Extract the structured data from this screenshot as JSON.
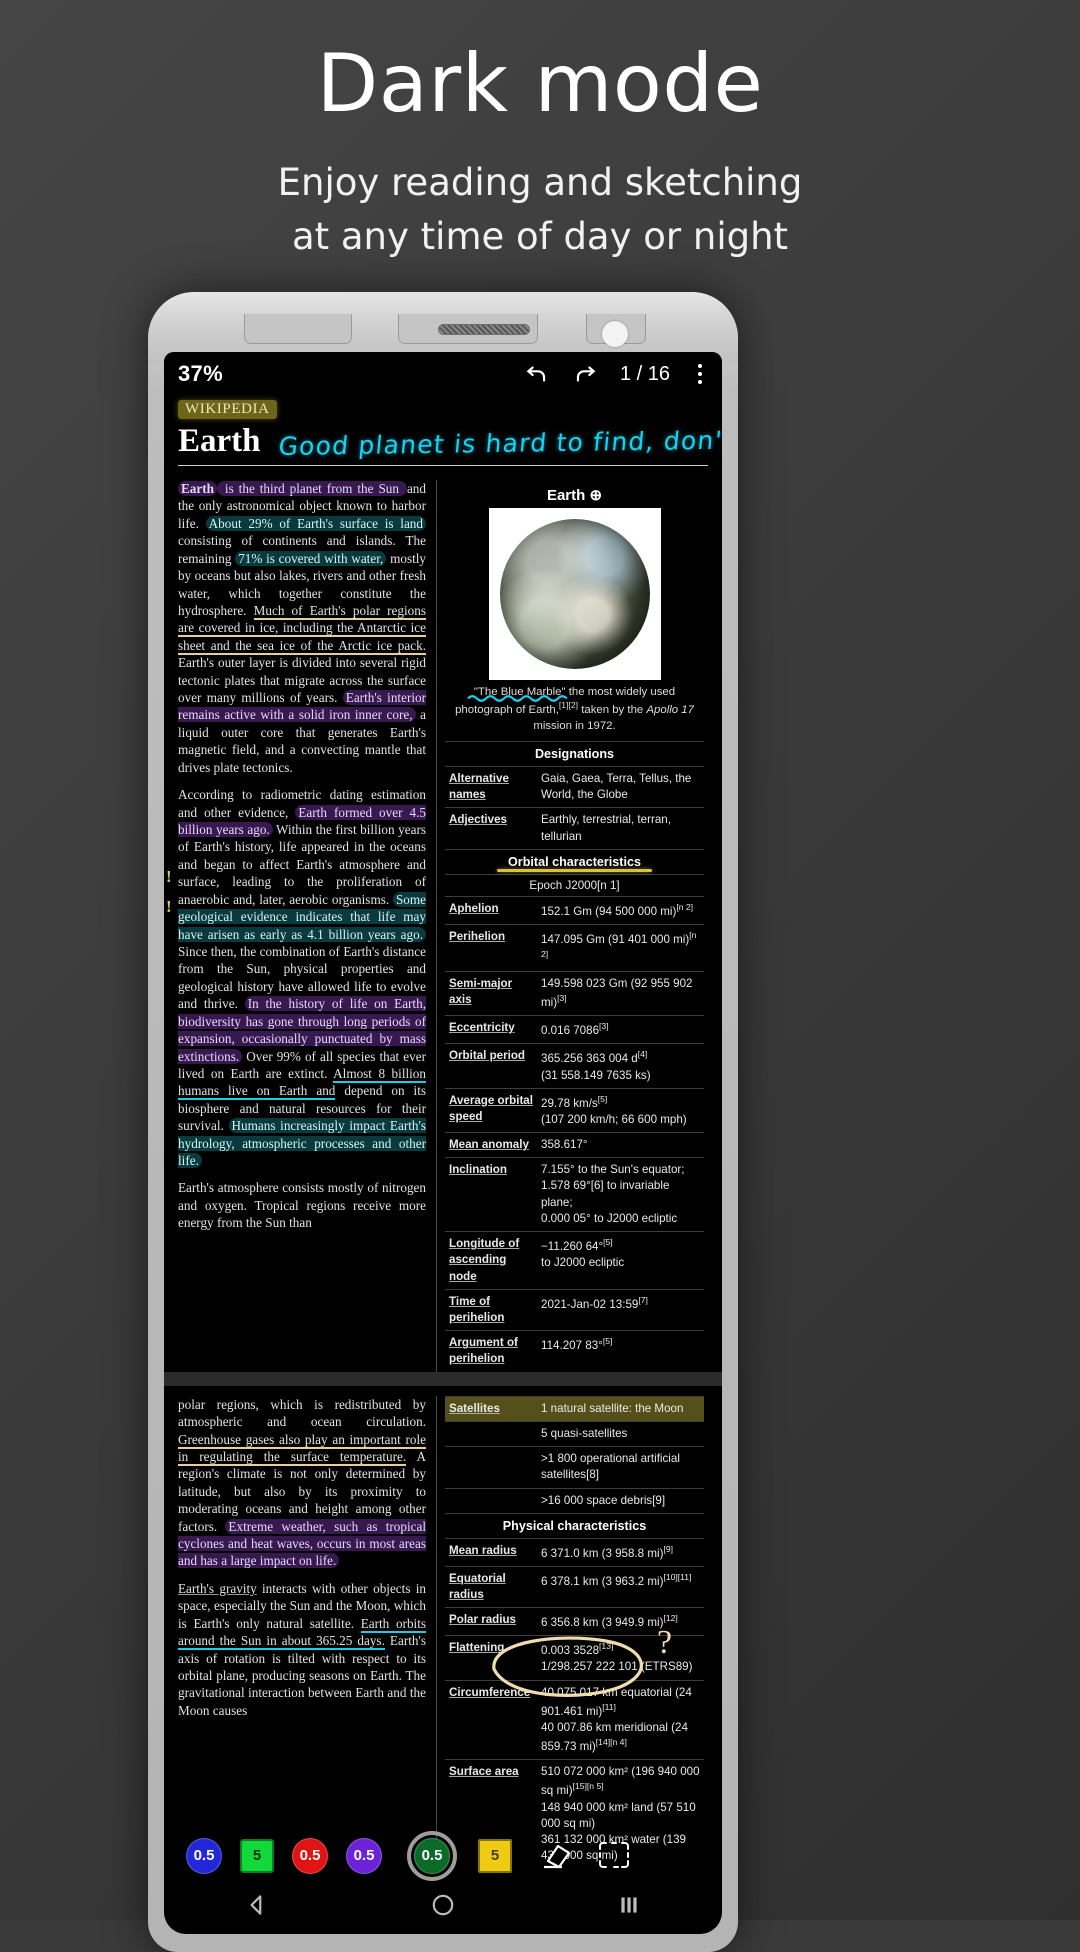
{
  "promo": {
    "title": "Dark mode",
    "subtitle_line1": "Enjoy reading and sketching",
    "subtitle_line2": "at any time of day or night"
  },
  "toolbar": {
    "zoom_level": "37%",
    "undo_icon": "undo-icon",
    "redo_icon": "redo-icon",
    "page_indicator": "1 / 16",
    "menu_icon": "overflow-menu-icon"
  },
  "document": {
    "source_badge": "WIKIPEDIA",
    "title": "Earth",
    "handwritten_note": "Good planet is hard to find, don't blow it !",
    "paragraph1": [
      {
        "t": "Earth",
        "s": "bold hl-purple"
      },
      {
        "t": " is the third planet from the Sun ",
        "s": "hl-purple"
      },
      {
        "t": "and the only astronomical object known to harbor life. ",
        "s": ""
      },
      {
        "t": "About 29% of Earth's surface is land ",
        "s": "hl-teal"
      },
      {
        "t": "consisting of continents and islands. The remaining ",
        "s": ""
      },
      {
        "t": "71% is covered with water,",
        "s": "hl-teal"
      },
      {
        "t": " mostly by oceans but also lakes, rivers and other fresh water, which together constitute the hydrosphere. ",
        "s": ""
      },
      {
        "t": "Much of Earth's polar regions are covered in ice, including the Antarctic ice sheet and the sea ice of the Arctic ice pack.",
        "s": "ul-tan"
      },
      {
        "t": " Earth's outer layer is divided into several rigid tectonic plates that migrate across the surface over many millions of years. ",
        "s": ""
      },
      {
        "t": "Earth's interior remains active with a solid iron inner core,",
        "s": "hl-purple"
      },
      {
        "t": " a liquid outer core that generates Earth's magnetic field, and a convecting mantle that drives plate tectonics.",
        "s": ""
      }
    ],
    "paragraph2": [
      {
        "t": "According to radiometric dating estimation and other evidence, ",
        "s": ""
      },
      {
        "t": "Earth formed over 4.5 billion years ago.",
        "s": "hl-purple"
      },
      {
        "t": " Within the first billion years of Earth's history, life appeared in the oceans and began to affect Earth's atmosphere and surface, leading to the proliferation of anaerobic and, later, aerobic organisms. ",
        "s": ""
      },
      {
        "t": "Some geological evidence indicates that life may have arisen as early as 4.1 billion years ago.",
        "s": "hl-teal"
      },
      {
        "t": " Since then, the combination of Earth's distance from the Sun, physical properties and geological history have allowed life to evolve and thrive. ",
        "s": ""
      },
      {
        "t": "In the history of life on Earth, biodiversity has gone through long periods of expansion, occasionally punctuated by mass extinctions.",
        "s": "hl-purple"
      },
      {
        "t": " Over 99% of all species that ever lived on Earth are extinct. ",
        "s": ""
      },
      {
        "t": "Almost 8 billion humans live on Earth and",
        "s": "ul-cyan"
      },
      {
        "t": " depend on its biosphere and natural resources for their survival. ",
        "s": ""
      },
      {
        "t": "Humans increasingly impact Earth's hydrology, atmospheric processes and other life.",
        "s": "hl-teal"
      }
    ],
    "paragraph3": [
      {
        "t": "Earth's atmosphere consists mostly of nitrogen and oxygen. Tropical regions receive more energy from the Sun than",
        "s": ""
      }
    ],
    "paragraph4": [
      {
        "t": "polar regions, which is redistributed by atmospheric and ocean circulation. ",
        "s": ""
      },
      {
        "t": "Greenhouse gases also play an important role in regulating the surface temperature.",
        "s": "ul-tan"
      },
      {
        "t": " A region's climate is not only determined by latitude, but also by its proximity to moderating oceans and height among other factors. ",
        "s": ""
      },
      {
        "t": "Extreme weather, such as tropical cyclones and heat waves, occurs in most areas and has a large impact on life.",
        "s": "hl-purple"
      }
    ],
    "paragraph5": [
      {
        "t": "Earth's gravity",
        "s": "u"
      },
      {
        "t": " interacts with other objects in space, especially the Sun and the Moon, which is Earth's only natural satellite. ",
        "s": ""
      },
      {
        "t": "Earth orbits around the Sun in about 365.25 days.",
        "s": "ul-cyan"
      },
      {
        "t": " Earth's axis of rotation is tilted with respect to its orbital plane, producing seasons on Earth. The gravitational interaction between Earth and the Moon causes",
        "s": ""
      }
    ]
  },
  "infobox": {
    "title": "Earth",
    "title_symbol": "⊕",
    "image_alt": "blue-marble-photo",
    "caption_quoted": "\"The Blue Marble\"",
    "caption_rest": " the most widely used photograph of Earth,",
    "caption_refs": "[1][2]",
    "caption_tail": " taken by the ",
    "caption_italic": "Apollo 17",
    "caption_end": " mission in 1972.",
    "sections": [
      {
        "heading": "Designations",
        "rows": [
          {
            "k": "Alternative names",
            "v": "Gaia, Gaea, Terra, Tellus, the World, the Globe"
          },
          {
            "k": "Adjectives",
            "v": "Earthly, terrestrial, terran, tellurian"
          }
        ]
      },
      {
        "heading": "Orbital characteristics",
        "highlight": "yellow-underline",
        "epoch": "Epoch J2000[n 1]",
        "rows": [
          {
            "k": "Aphelion",
            "v": "152.1 Gm (94 500 000 mi)",
            "ref": "[n 2]"
          },
          {
            "k": "Perihelion",
            "v": "147.095 Gm (91 401 000 mi)",
            "ref": "[n 2]"
          },
          {
            "k": "Semi-major axis",
            "v": "149.598 023 Gm (92 955 902 mi)",
            "ref": "[3]"
          },
          {
            "k": "Eccentricity",
            "v": "0.016 7086",
            "ref": "[3]"
          },
          {
            "k": "Orbital period",
            "v": "365.256 363 004 d",
            "ref": "[4]",
            "v2": "(31 558.149 7635 ks)"
          },
          {
            "k": "Average orbital speed",
            "v": "29.78 km/s",
            "ref": "[5]",
            "v2": "(107 200 km/h; 66 600 mph)"
          },
          {
            "k": "Mean anomaly",
            "v": "358.617°",
            "ref": ""
          },
          {
            "k": "Inclination",
            "v": "7.155° to the Sun's equator;",
            "ref": "",
            "v2": "1.578 69°[6] to invariable plane;",
            "v3": "0.000 05° to J2000 ecliptic"
          },
          {
            "k": "Longitude of ascending node",
            "v": "−11.260 64°",
            "ref": "[5]",
            "v2": " to J2000 ecliptic"
          },
          {
            "k": "Time of perihelion",
            "v": "2021-Jan-02 13:59",
            "ref": "[7]"
          },
          {
            "k": "Argument of perihelion",
            "v": "114.207 83°",
            "ref": "[5]"
          }
        ]
      }
    ],
    "page2": {
      "satellites_key": "Satellites",
      "satellites_values": [
        "1 natural satellite: the Moon",
        "5 quasi-satellites",
        ">1 800 operational artificial satellites[8]",
        ">16 000 space debris[9]"
      ],
      "physical_heading": "Physical characteristics",
      "rows": [
        {
          "k": "Mean radius",
          "v": "6 371.0 km (3 958.8 mi)",
          "ref": "[9]"
        },
        {
          "k": "Equatorial radius",
          "v": "6 378.1 km (3 963.2 mi)",
          "ref": "[10][11]"
        },
        {
          "k": "Polar radius",
          "v": "6 356.8 km (3 949.9 mi)",
          "ref": "[12]"
        },
        {
          "k": "Flattening",
          "v": "0.003 3528",
          "ref": "[13]",
          "v2": "1/298.257 222 101 (ETRS89)"
        },
        {
          "k": "Circumference",
          "v": "40 075.017 km equatorial (24 901.461 mi)",
          "ref": "[11]",
          "v2": "40 007.86 km meridional (24 859.73 mi)",
          "ref2": "[14][n 4]"
        },
        {
          "k": "Surface area",
          "v": "510 072 000 km² (196 940 000 sq mi)",
          "ref": "[15][n 5]",
          "v2": "148 940 000 km² land (57 510 000 sq mi)",
          "v3": "361 132 000 km² water (139 434 000 sq mi)"
        }
      ]
    }
  },
  "pen_toolbar": {
    "tools": [
      {
        "name": "pen-blue",
        "label": "0.5",
        "color": "#2227d8",
        "shape": "circle",
        "selected": false
      },
      {
        "name": "highlighter-green",
        "label": "5",
        "color": "#12d93a",
        "shape": "square",
        "selected": false
      },
      {
        "name": "pen-red",
        "label": "0.5",
        "color": "#e01414",
        "shape": "circle",
        "selected": false
      },
      {
        "name": "pen-violet",
        "label": "0.5",
        "color": "#6b22d8",
        "shape": "circle",
        "selected": false
      },
      {
        "name": "pen-green",
        "label": "0.5",
        "color": "#0a6a2a",
        "shape": "circle",
        "selected": true
      },
      {
        "name": "highlighter-yellow",
        "label": "5",
        "color": "#f0cb14",
        "shape": "square",
        "selected": false
      }
    ],
    "eraser_icon": "eraser-icon",
    "lasso_icon": "lasso-select-icon"
  },
  "navbar": {
    "back_icon": "back-triangle-icon",
    "home_icon": "home-circle-icon",
    "recents_icon": "recents-bars-icon"
  },
  "annotations": {
    "circle_polar_radius": "hand-drawn-ellipse",
    "question_mark": "?"
  }
}
